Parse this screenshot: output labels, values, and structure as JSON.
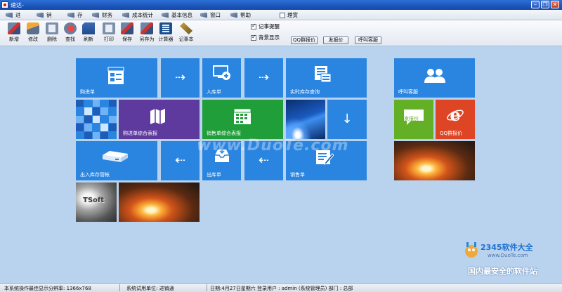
{
  "window": {
    "title": "速达-"
  },
  "menu": {
    "items": [
      "进",
      "销",
      "存",
      "财务",
      "成本统计",
      "基本信息",
      "窗口",
      "帮助"
    ],
    "theme_label": "理赏"
  },
  "toolbar": {
    "tools": [
      {
        "label": "新增",
        "icon": "new-doc-icon"
      },
      {
        "label": "修改",
        "icon": "edit-pencil-icon"
      },
      {
        "label": "删除",
        "icon": "delete-icon"
      },
      {
        "label": "查找",
        "icon": "search-icon"
      },
      {
        "label": "刷新",
        "icon": "refresh-icon"
      },
      {
        "label": "打印",
        "icon": "print-icon"
      },
      {
        "label": "保存",
        "icon": "save-icon"
      },
      {
        "label": "另存为",
        "icon": "save-as-icon"
      },
      {
        "label": "计算器",
        "icon": "calculator-icon"
      },
      {
        "label": "记事本",
        "icon": "notepad-icon"
      }
    ],
    "check_reminder": "记事提醒",
    "check_background": "背景显示",
    "btn_qq_quote": "QQ群报价",
    "btn_send_quote": "发报价",
    "btn_call_service": "呼叫客服"
  },
  "tiles": {
    "purchase": "购进单",
    "inbound": "入库单",
    "realtime_stock": "实时库存查询",
    "call_service": "呼叫客服",
    "purchase_report": "购进单综合表报",
    "sales_report": "销售单综合表报",
    "send_quote": "发报价",
    "qq_quote": "QQ群报价",
    "inout_ledger": "出入库存管帐",
    "outbound": "出库单",
    "sales": "销售单",
    "tsoft_logo": "TSoft"
  },
  "watermark": {
    "site": "www.DuoTe.com",
    "brand": "2345软件大全",
    "brand_url": "www.DuoTe.com",
    "slogan": "国内最安全的软件站"
  },
  "status": {
    "resolution": "本系统操作最佳显示分辨率: 1366x768",
    "trial_unit": "系统试用单位: 进销通",
    "date_user": "日期:4月27日星期六 登录用户 : admin (系统管理员) 部门 : 总部"
  },
  "colors": {
    "tile_blue": "#2a85e0",
    "tile_purple": "#5e3a9e",
    "tile_green": "#1f9e3a",
    "tile_light_green": "#63b027",
    "tile_red": "#dd4524",
    "desktop_bg": "#b9d3ef"
  }
}
